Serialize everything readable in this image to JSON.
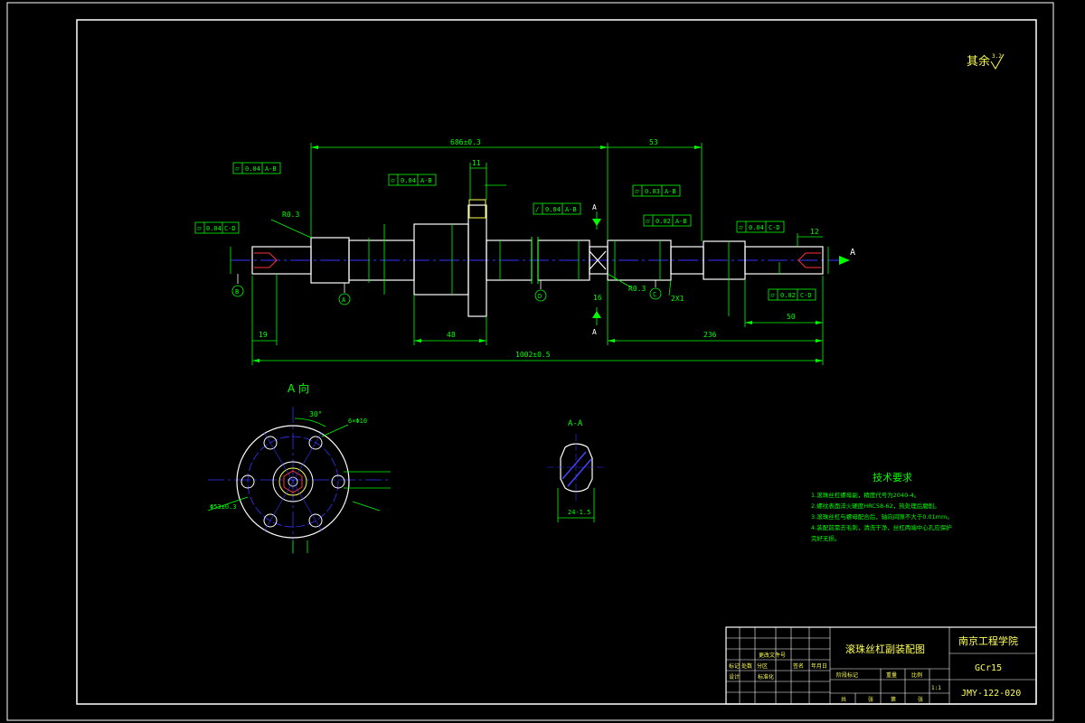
{
  "colors": {
    "background": "#000000",
    "frame": "#ffffff",
    "outline": "#ffffff",
    "dimension": "#00ff00",
    "centerline": "#3333ff",
    "hatch": "#4444ff",
    "text_green": "#00ff00",
    "text_yellow": "#ffff55",
    "accent_red": "#ff3333"
  },
  "roughness_note": {
    "label": "其余",
    "value": "3.2"
  },
  "main_view": {
    "dimensions": {
      "total_length": "1002±0.5",
      "span_left": "686±0.3",
      "span_right": "53",
      "len_236": "236",
      "len_48": "48",
      "len_19": "19",
      "len_50": "50",
      "len_12": "12",
      "len_11": "11",
      "len_16": "16",
      "len_2x1": "2X1"
    },
    "labels": {
      "r3a": "R0.3",
      "r3b": "R0.3",
      "a_left": "A",
      "a_right": "A",
      "view_arrow_a": "A"
    },
    "datums": {
      "A": "A",
      "B": "B",
      "C": "C",
      "D": "D"
    },
    "tolerance_frames": [
      {
        "symbol": "⌭",
        "value": "0.04",
        "datum": "A-B"
      },
      {
        "symbol": "⌭",
        "value": "0.04",
        "datum": "A-B"
      },
      {
        "symbol": "/",
        "value": "0.04",
        "datum": "A-B"
      },
      {
        "symbol": "⌭",
        "value": "0.03",
        "datum": "A-B"
      },
      {
        "symbol": "⌭",
        "value": "0.02",
        "datum": "A-B"
      },
      {
        "symbol": "⌭",
        "value": "0.04",
        "datum": "C-D"
      },
      {
        "symbol": "⌭",
        "value": "0.04",
        "datum": "C-D"
      },
      {
        "symbol": "⌭",
        "value": "0.02",
        "datum": "C-D"
      }
    ]
  },
  "view_a": {
    "title": "A 向",
    "angle": "30°",
    "holes": "6×Φ10",
    "pcd": "Φ53±0.3"
  },
  "section_aa": {
    "title": "A-A",
    "width": "24-1.5"
  },
  "tech_requirements": {
    "title": "技术要求",
    "lines": [
      "1.滚珠丝杠螺母副，精度代号为2040-4。",
      "2.螺纹表面淬火硬度HRC58-62，热处理后磨削。",
      "3.滚珠丝杠与螺母配合后，轴向间隙不大于0.01mm。",
      "4.装配前需去毛刺，清洗干净，丝杠两端中心孔应保护",
      "完好无损。"
    ]
  },
  "title_block": {
    "drawing_title": "滚珠丝杠副装配图",
    "school": "南京工程学院",
    "material": "GCr15",
    "drawing_number": "JMY-122-020",
    "scale": "1:1",
    "head_row": [
      "阶段标记",
      "重量",
      "比例"
    ],
    "sign_row": [
      "标记",
      "处数",
      "分区",
      "更改文件号",
      "签名",
      "年月日"
    ],
    "role_row": [
      "设计",
      "标准化"
    ],
    "bottom_row": [
      "共",
      "张",
      "第",
      "张"
    ]
  }
}
